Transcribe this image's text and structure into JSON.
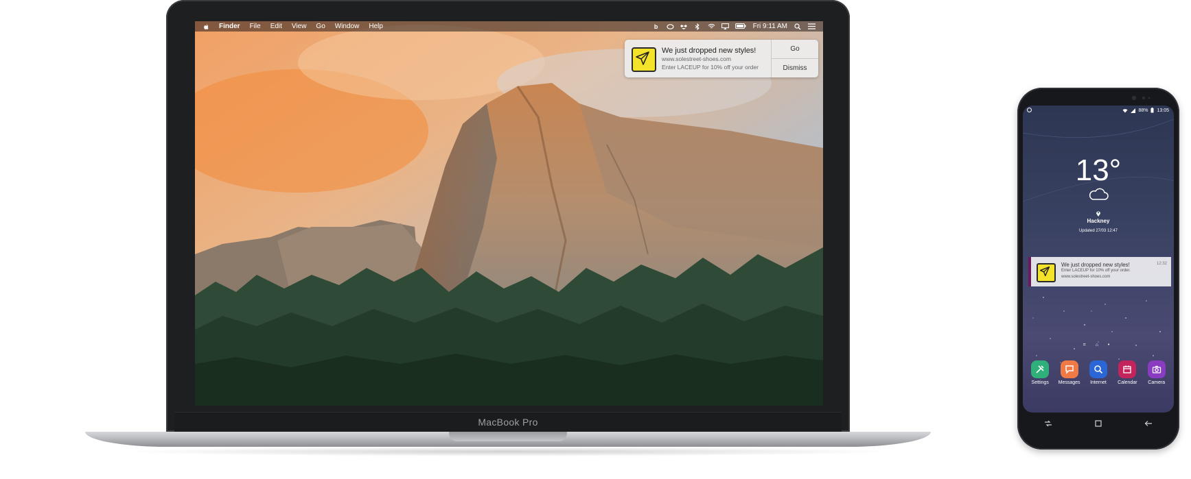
{
  "macbook": {
    "label": "MacBook Pro",
    "menubar": {
      "apple": "",
      "app": "Finder",
      "menus": [
        "File",
        "Edit",
        "View",
        "Go",
        "Window",
        "Help"
      ],
      "status_icons": [
        "b-app-icon",
        "creative-cloud-icon",
        "dropbox-icon",
        "bluetooth-icon",
        "wifi-icon",
        "airplay-icon",
        "battery-icon"
      ],
      "clock": "Fri 9:11 AM",
      "right_icons": [
        "spotlight-icon",
        "notification-center-icon"
      ]
    },
    "notification": {
      "title": "We just dropped new styles!",
      "site": "www.solestreet-shoes.com",
      "body": "Enter LACEUP for 10% off your order",
      "go_label": "Go",
      "dismiss_label": "Dismiss"
    }
  },
  "phone": {
    "status": {
      "battery": "88%",
      "time": "13:05"
    },
    "weather": {
      "temperature": "13°",
      "location": "Hackney",
      "updated": "Updated 27/03 12:47"
    },
    "notification": {
      "title": "We just dropped new styles!",
      "body": "Enter LACEUP for 10% off your order.",
      "site": "www.solestreet-shoes.com",
      "time": "12:32"
    },
    "page_indicator": "= ⌂ •",
    "dock": [
      {
        "label": "Settings",
        "color": "#2fb07a"
      },
      {
        "label": "Messages",
        "color": "#f07a45"
      },
      {
        "label": "Internet",
        "color": "#2a66d6"
      },
      {
        "label": "Calendar",
        "color": "#c2245b"
      },
      {
        "label": "Camera",
        "color": "#8a3cc0"
      }
    ]
  },
  "colors": {
    "notification_icon_yellow": "#f4e32b",
    "phone_notification_accent": "#6a1b5a"
  }
}
